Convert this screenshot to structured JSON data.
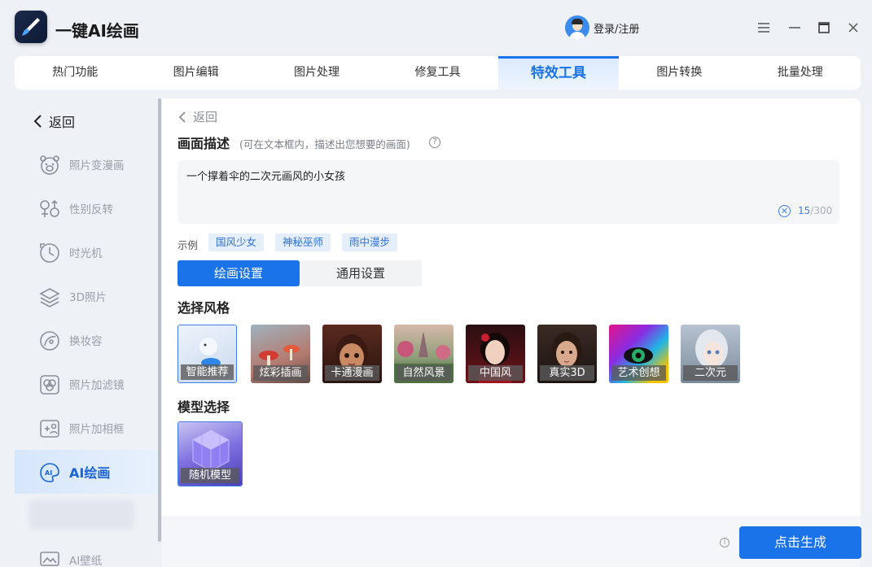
{
  "app": {
    "title": "一键AI绘画",
    "login_label": "登录/注册"
  },
  "tabs": [
    {
      "label": "热门功能"
    },
    {
      "label": "图片编辑"
    },
    {
      "label": "图片处理"
    },
    {
      "label": "修复工具"
    },
    {
      "label": "特效工具",
      "active": true
    },
    {
      "label": "图片转换"
    },
    {
      "label": "批量处理"
    }
  ],
  "sidebar": {
    "back_label": "返回",
    "items": [
      {
        "label": "照片变漫画",
        "icon": "bear-face-icon"
      },
      {
        "label": "性别反转",
        "icon": "gender-icon"
      },
      {
        "label": "时光机",
        "icon": "clock-icon"
      },
      {
        "label": "3D照片",
        "icon": "layers-icon"
      },
      {
        "label": "换妆容",
        "icon": "makeup-icon"
      },
      {
        "label": "照片加滤镜",
        "icon": "filter-icon"
      },
      {
        "label": "照片加相框",
        "icon": "frame-icon"
      },
      {
        "label": "AI绘画",
        "icon": "ai-paint-icon",
        "active": true
      },
      {
        "label": "AI壁纸",
        "icon": "wallpaper-icon"
      }
    ]
  },
  "main": {
    "back_label": "返回",
    "description": {
      "title": "画面描述",
      "hint": "(可在文本框内，描述出您想要的画面)",
      "value": "一个撑着伞的二次元画风的小女孩",
      "count": "15",
      "max": "/300"
    },
    "examples": {
      "label": "示例",
      "items": [
        "国风少女",
        "神秘巫师",
        "雨中漫步"
      ]
    },
    "settings_tabs": {
      "paint": "绘画设置",
      "general": "通用设置"
    },
    "style_section": {
      "title": "选择风格",
      "styles": [
        {
          "label": "智能推荐",
          "selected": true
        },
        {
          "label": "炫彩插画"
        },
        {
          "label": "卡通漫画"
        },
        {
          "label": "自然风景"
        },
        {
          "label": "中国风"
        },
        {
          "label": "真实3D"
        },
        {
          "label": "艺术创想"
        },
        {
          "label": "二次元"
        }
      ]
    },
    "model_section": {
      "title": "模型选择",
      "model_label": "随机模型"
    }
  },
  "footer": {
    "generate_label": "点击生成"
  },
  "colors": {
    "accent": "#1a73e8",
    "sidebar_bg": "#eef1f6",
    "chip_bg": "#e5effc"
  }
}
